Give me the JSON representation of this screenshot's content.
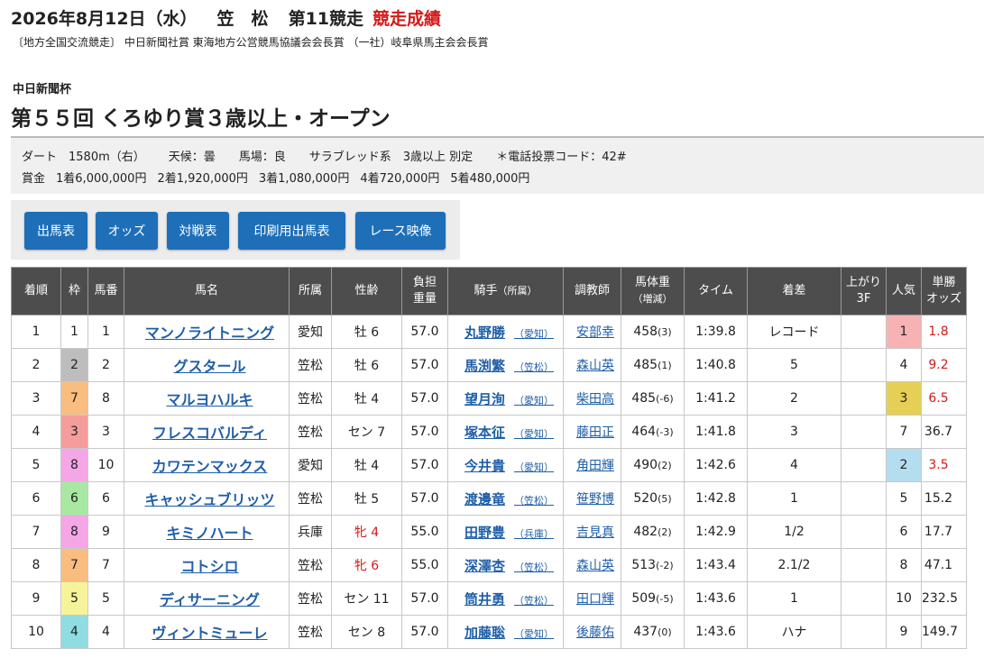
{
  "header": {
    "date": "2026年8月12日（水）",
    "course": "笠　松",
    "race_no": "第11競走",
    "result_label": "競走成績"
  },
  "sponsor": "〔地方全国交流競走〕 中日新聞社賞 東海地方公営競馬協議会会長賞 （一社）岐阜県馬主会会長賞",
  "cup": "中日新聞杯",
  "title": "第５５回 くろゆり賞３歳以上・オープン",
  "info": {
    "track": "ダート　1580m（右）",
    "weather": "天候：曇",
    "going": "馬場：良",
    "breed": "サラブレッド系　3歳以上 別定",
    "phone": "＊電話投票コード：42#",
    "prize_label": "賞金",
    "prizes": [
      "1着6,000,000円",
      "2着1,920,000円",
      "3着1,080,000円",
      "4着720,000円",
      "5着480,000円"
    ]
  },
  "buttons": [
    "出馬表",
    "オッズ",
    "対戦表",
    "印刷用出馬表",
    "レース映像"
  ],
  "columns": {
    "rank": "着順",
    "frame": "枠",
    "number": "馬番",
    "horse": "馬名",
    "belong": "所属",
    "sexage": "性齢",
    "weight_l1": "負担",
    "weight_l2": "重量",
    "jockey": "騎手",
    "jockey_sub": "（所属）",
    "trainer": "調教師",
    "body_l1": "馬体重",
    "body_l2": "（増減）",
    "time": "タイム",
    "margin": "着差",
    "last3f_l1": "上がり",
    "last3f_l2": "3F",
    "pop": "人気",
    "odds_l1": "単勝",
    "odds_l2": "オッズ"
  },
  "rows": [
    {
      "rank": "1",
      "frame": "1",
      "frame_color": "#ffffff",
      "num": "1",
      "horse": "マンノライトニング",
      "belong": "愛知",
      "sexage": "牡 6",
      "female": false,
      "weight": "57.0",
      "jockey": "丸野勝",
      "jaff": "（愛知）",
      "trainer": "安部幸",
      "body": "458",
      "diff": "(3)",
      "time": "1:39.8",
      "margin": "レコード",
      "last3f": "",
      "pop": "1",
      "pop_color": "#f7b3b3",
      "odds": "1.8",
      "top": true
    },
    {
      "rank": "2",
      "frame": "2",
      "frame_color": "#bdbdbd",
      "num": "2",
      "horse": "グスタール",
      "belong": "笠松",
      "sexage": "牡 6",
      "female": false,
      "weight": "57.0",
      "jockey": "馬渕繁",
      "jaff": "（笠松）",
      "trainer": "森山英",
      "body": "485",
      "diff": "(1)",
      "time": "1:40.8",
      "margin": "5",
      "last3f": "",
      "pop": "4",
      "pop_color": "",
      "odds": "9.2",
      "top": true
    },
    {
      "rank": "3",
      "frame": "7",
      "frame_color": "#f9bd7f",
      "num": "8",
      "horse": "マルヨハルキ",
      "belong": "笠松",
      "sexage": "牡 4",
      "female": false,
      "weight": "57.0",
      "jockey": "望月洵",
      "jaff": "（愛知）",
      "trainer": "柴田高",
      "body": "485",
      "diff": "(-6)",
      "time": "1:41.2",
      "margin": "2",
      "last3f": "",
      "pop": "3",
      "pop_color": "#e6cf55",
      "odds": "6.5",
      "top": true
    },
    {
      "rank": "4",
      "frame": "3",
      "frame_color": "#f59c9c",
      "num": "3",
      "horse": "フレスコバルディ",
      "belong": "笠松",
      "sexage": "セン 7",
      "female": false,
      "weight": "57.0",
      "jockey": "塚本征",
      "jaff": "（愛知）",
      "trainer": "藤田正",
      "body": "464",
      "diff": "(-3)",
      "time": "1:41.8",
      "margin": "3",
      "last3f": "",
      "pop": "7",
      "pop_color": "",
      "odds": "36.7",
      "top": false
    },
    {
      "rank": "5",
      "frame": "8",
      "frame_color": "#f5a6e6",
      "num": "10",
      "horse": "カワテンマックス",
      "belong": "愛知",
      "sexage": "牡 4",
      "female": false,
      "weight": "57.0",
      "jockey": "今井貴",
      "jaff": "（愛知）",
      "trainer": "角田輝",
      "body": "490",
      "diff": "(2)",
      "time": "1:42.6",
      "margin": "4",
      "last3f": "",
      "pop": "2",
      "pop_color": "#b5ddf0",
      "odds": "3.5",
      "top": true
    },
    {
      "rank": "6",
      "frame": "6",
      "frame_color": "#a9e8a3",
      "num": "6",
      "horse": "キャッシュブリッツ",
      "belong": "笠松",
      "sexage": "牡 5",
      "female": false,
      "weight": "57.0",
      "jockey": "渡邊竜",
      "jaff": "（笠松）",
      "trainer": "笹野博",
      "body": "520",
      "diff": "(5)",
      "time": "1:42.8",
      "margin": "1",
      "last3f": "",
      "pop": "5",
      "pop_color": "",
      "odds": "15.2",
      "top": false
    },
    {
      "rank": "7",
      "frame": "8",
      "frame_color": "#f5a6e6",
      "num": "9",
      "horse": "キミノハート",
      "belong": "兵庫",
      "sexage": "牝 4",
      "female": true,
      "weight": "55.0",
      "jockey": "田野豊",
      "jaff": "（兵庫）",
      "trainer": "吉見真",
      "body": "482",
      "diff": "(2)",
      "time": "1:42.9",
      "margin": "1/2",
      "last3f": "",
      "pop": "6",
      "pop_color": "",
      "odds": "17.7",
      "top": false
    },
    {
      "rank": "8",
      "frame": "7",
      "frame_color": "#f9bd7f",
      "num": "7",
      "horse": "コトシロ",
      "belong": "笠松",
      "sexage": "牝 6",
      "female": true,
      "weight": "55.0",
      "jockey": "深澤杏",
      "jaff": "（笠松）",
      "trainer": "森山英",
      "body": "513",
      "diff": "(-2)",
      "time": "1:43.4",
      "margin": "2.1/2",
      "last3f": "",
      "pop": "8",
      "pop_color": "",
      "odds": "47.1",
      "top": false
    },
    {
      "rank": "9",
      "frame": "5",
      "frame_color": "#f7f39a",
      "num": "5",
      "horse": "ディサーニング",
      "belong": "笠松",
      "sexage": "セン 11",
      "female": false,
      "weight": "57.0",
      "jockey": "筒井勇",
      "jaff": "（笠松）",
      "trainer": "田口輝",
      "body": "509",
      "diff": "(-5)",
      "time": "1:43.6",
      "margin": "1",
      "last3f": "",
      "pop": "10",
      "pop_color": "",
      "odds": "232.5",
      "top": false
    },
    {
      "rank": "10",
      "frame": "4",
      "frame_color": "#8fdde2",
      "num": "4",
      "horse": "ヴィントミューレ",
      "belong": "笠松",
      "sexage": "セン 8",
      "female": false,
      "weight": "57.0",
      "jockey": "加藤聡",
      "jaff": "（愛知）",
      "trainer": "後藤佑",
      "body": "437",
      "diff": "(0)",
      "time": "1:43.6",
      "margin": "ハナ",
      "last3f": "",
      "pop": "9",
      "pop_color": "",
      "odds": "149.7",
      "top": false
    }
  ]
}
